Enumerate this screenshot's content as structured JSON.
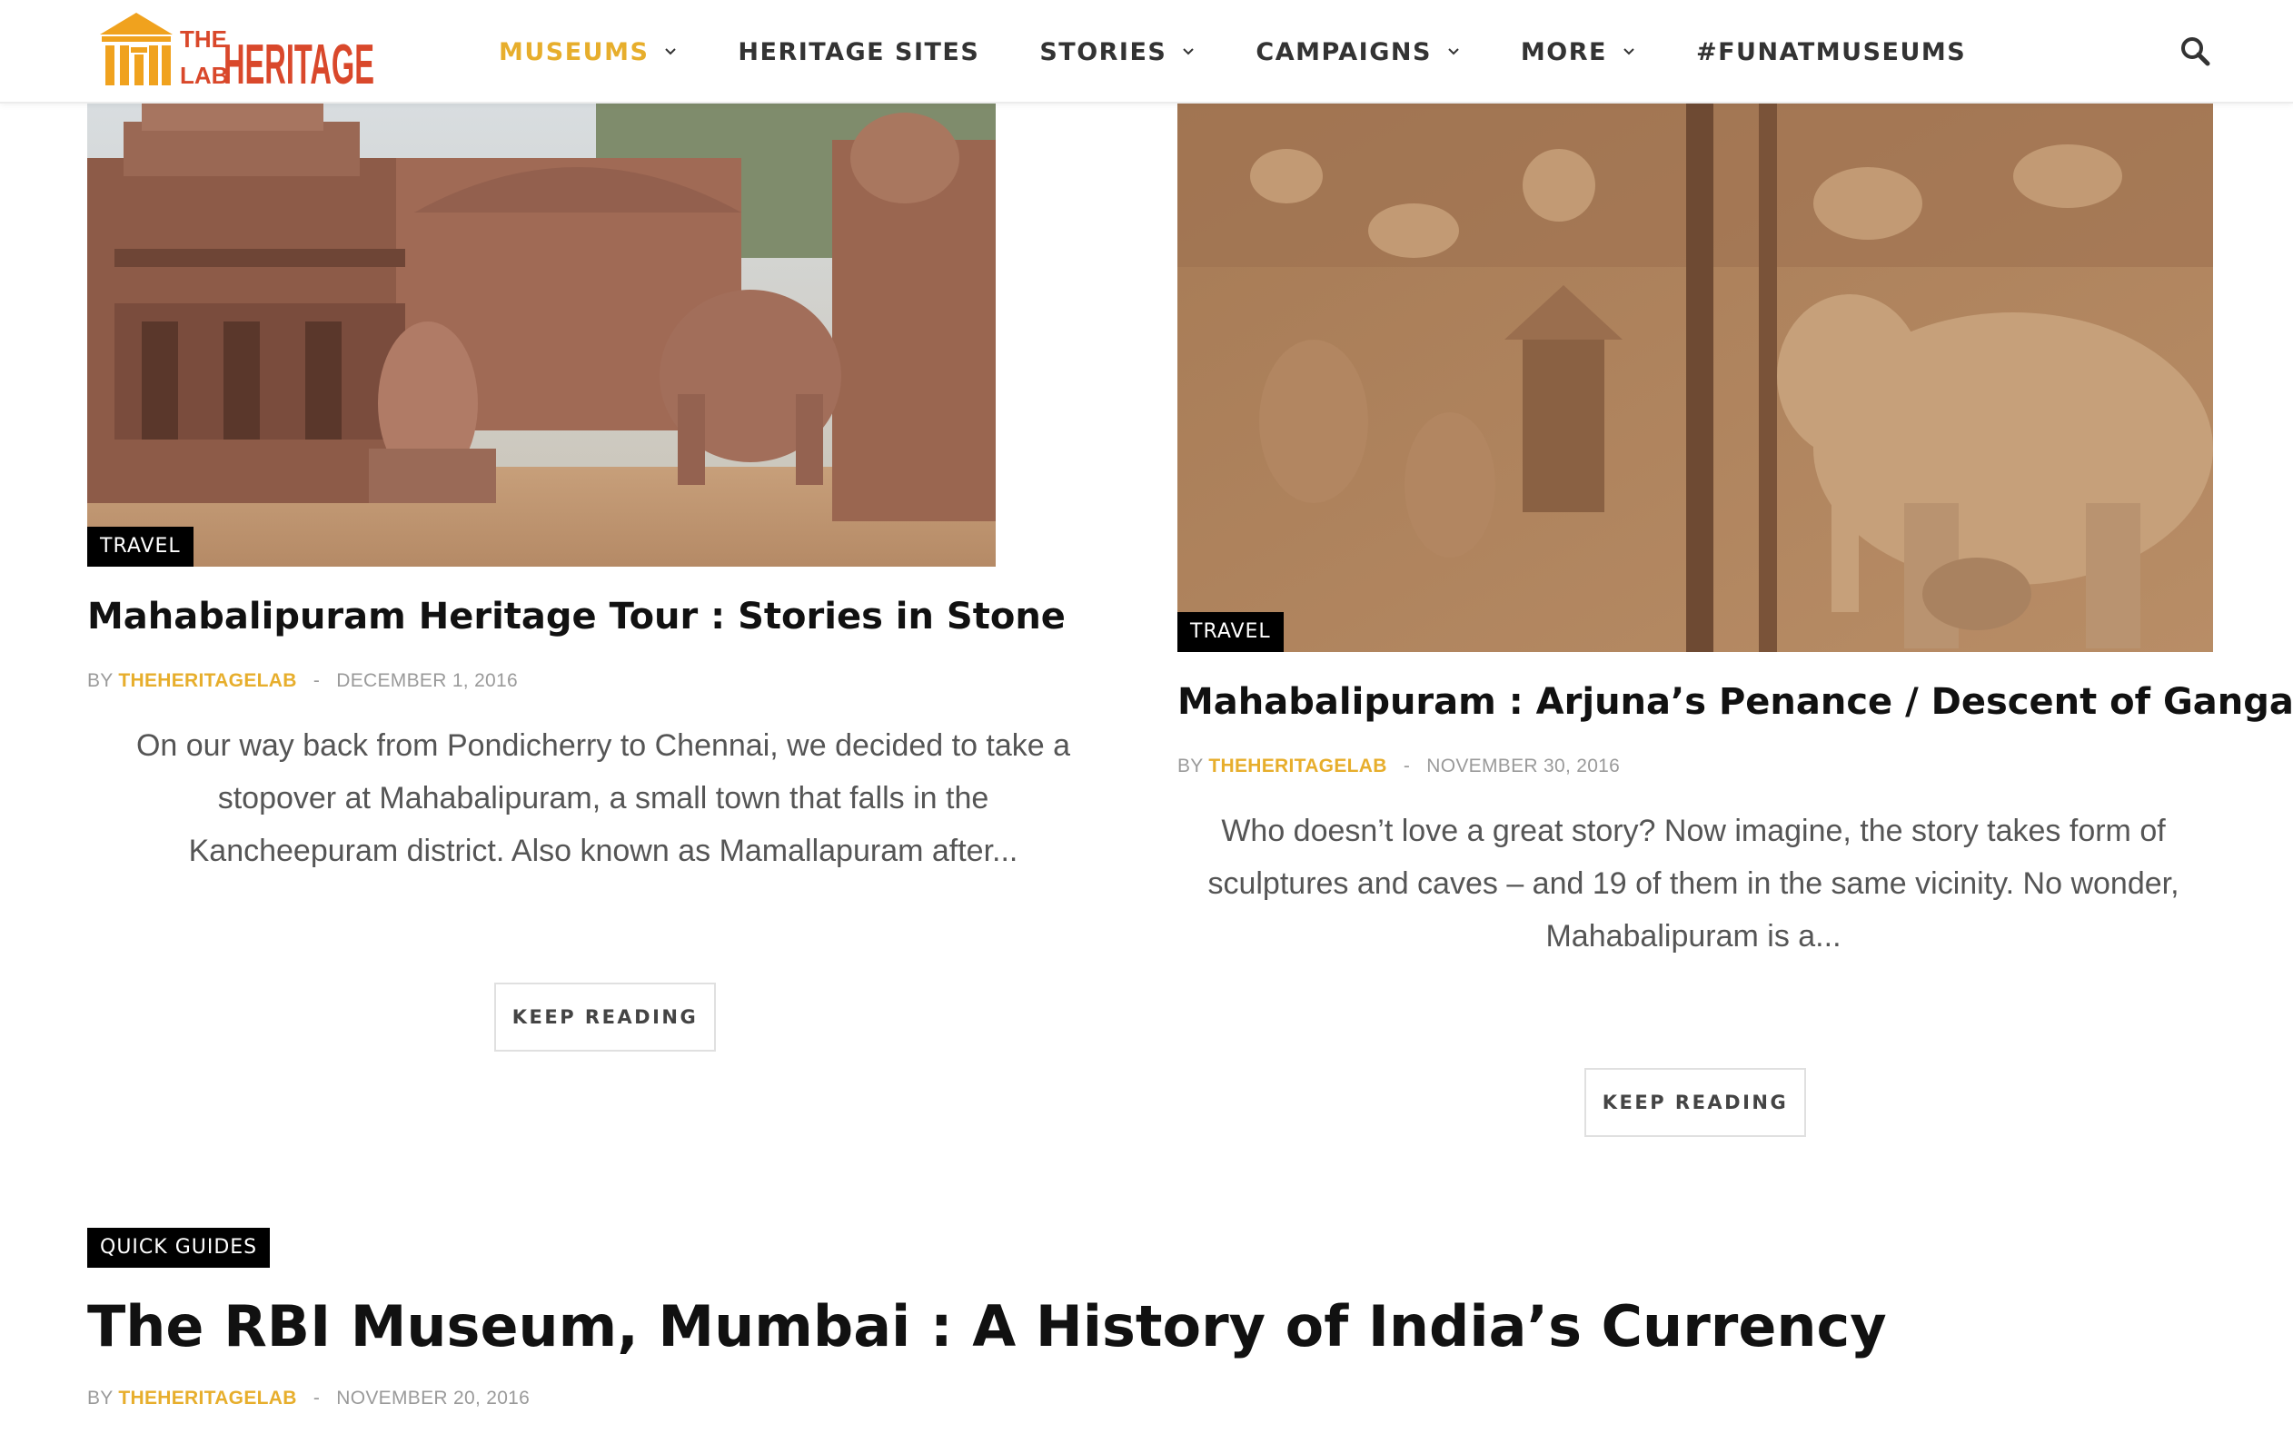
{
  "brand": {
    "logo_text_small_top": "THE",
    "logo_text_small_bottom": "LAB",
    "logo_text_big": "HERITAGE",
    "accent_color": "#e7ae2c",
    "logo_color": "#d9482b"
  },
  "nav": {
    "items": [
      {
        "label": "MUSEUMS",
        "dropdown": true,
        "active": true
      },
      {
        "label": "HERITAGE SITES",
        "dropdown": false
      },
      {
        "label": "STORIES",
        "dropdown": true
      },
      {
        "label": "CAMPAIGNS",
        "dropdown": true
      },
      {
        "label": "MORE",
        "dropdown": true
      },
      {
        "label": "#FUNATMUSEUMS",
        "dropdown": false
      }
    ],
    "search_icon": "search-icon"
  },
  "posts": [
    {
      "category": "TRAVEL",
      "title": "Mahabalipuram Heritage Tour : Stories in Stone",
      "by": "BY",
      "author": "THEHERITAGELAB",
      "sep": "-",
      "date": "DECEMBER 1, 2016",
      "excerpt_lines": [
        "On our way back from Pondicherry to Chennai, we decided to take a",
        "stopover at Mahabalipuram, a small town that falls in the",
        "Kancheepuram district. Also known as Mamallapuram after..."
      ],
      "button": "KEEP READING"
    },
    {
      "category": "TRAVEL",
      "title": "Mahabalipuram : Arjuna’s Penance / Descent of Ganga",
      "by": "BY",
      "author": "THEHERITAGELAB",
      "sep": "-",
      "date": "NOVEMBER 30, 2016",
      "excerpt_lines": [
        "Who doesn’t love a great story? Now imagine, the story takes form of",
        "sculptures and caves – and 19 of them in the same vicinity. No wonder,",
        "Mahabalipuram is a..."
      ],
      "button": "KEEP READING"
    },
    {
      "category": "QUICK GUIDES",
      "title": "The RBI Museum, Mumbai : A History of India’s Currency",
      "by": "BY",
      "author": "THEHERITAGELAB",
      "sep": "-",
      "date": "NOVEMBER 20, 2016"
    }
  ]
}
